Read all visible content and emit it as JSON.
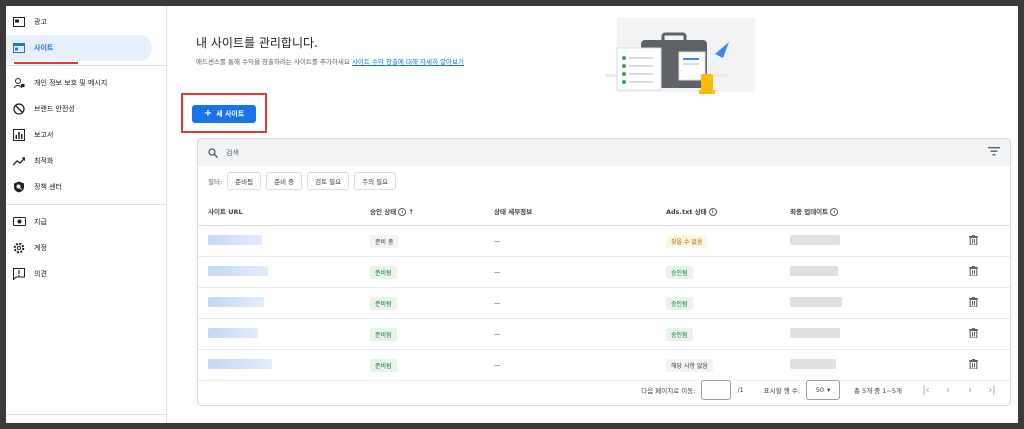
{
  "sidebar": {
    "items": [
      {
        "label": "광고",
        "icon": "ad-icon"
      },
      {
        "label": "사이트",
        "icon": "site-icon",
        "active": true
      },
      {
        "label": "개인 정보 보호 및 메시지",
        "icon": "privacy-icon"
      },
      {
        "label": "브랜드 안전성",
        "icon": "block-icon"
      },
      {
        "label": "보고서",
        "icon": "report-icon"
      },
      {
        "label": "최적화",
        "icon": "trend-icon"
      },
      {
        "label": "정책 센터",
        "icon": "policy-icon"
      },
      {
        "label": "지급",
        "icon": "payment-icon"
      },
      {
        "label": "계정",
        "icon": "gear-icon"
      },
      {
        "label": "의견",
        "icon": "feedback-icon"
      }
    ]
  },
  "header": {
    "title": "내 사이트를 관리합니다.",
    "subtitle": "애드센스를 통해 수익을 창출하려는 사이트를 추가하세요",
    "link": "사이트 수익 창출에 대해 자세히 알아보기"
  },
  "new_site_button": "새 사이트",
  "search": {
    "placeholder": "검색"
  },
  "filters": {
    "label": "필터:",
    "chips": [
      "준비됨",
      "준비 중",
      "검토 필요",
      "주의 필요"
    ]
  },
  "table": {
    "headers": [
      "사이트 URL",
      "승인 상태",
      "상태 세부정보",
      "Ads.txt 상태",
      "최종 업데이트"
    ],
    "rows": [
      {
        "approval": "준비 중",
        "approval_style": "grey",
        "detail": "—",
        "ads": "찾을 수 없음",
        "ads_style": "yellow"
      },
      {
        "approval": "준비됨",
        "approval_style": "green",
        "detail": "—",
        "ads": "승인됨",
        "ads_style": "green"
      },
      {
        "approval": "준비됨",
        "approval_style": "green",
        "detail": "—",
        "ads": "승인됨",
        "ads_style": "green"
      },
      {
        "approval": "준비됨",
        "approval_style": "green",
        "detail": "—",
        "ads": "승인됨",
        "ads_style": "green"
      },
      {
        "approval": "준비됨",
        "approval_style": "green",
        "detail": "—",
        "ads": "해당 사항 없음",
        "ads_style": "grey"
      }
    ]
  },
  "footer": {
    "goto_label": "다음 페이지로 이동:",
    "page_total": "/1",
    "rows_label": "표시할 행 수:",
    "rows_value": "50",
    "range": "총 5개 중 1~5개"
  }
}
